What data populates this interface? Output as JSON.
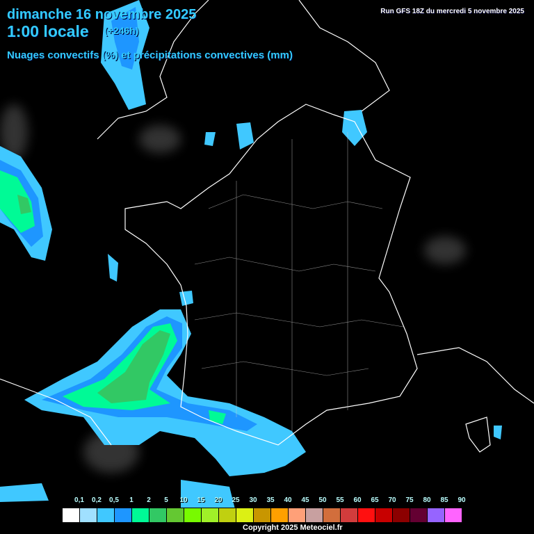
{
  "header": {
    "date": "dimanche 16 novembre 2025",
    "time": "1:00 locale",
    "lead": "(+246h)",
    "subtitle": "Nuages convectifs (%) et précipitations convectives (mm)",
    "run": "Run GFS 18Z du mercredi 5 novembre 2025"
  },
  "legend": {
    "labels": [
      "0,1",
      "0,2",
      "0,5",
      "1",
      "2",
      "5",
      "10",
      "15",
      "20",
      "25",
      "30",
      "35",
      "40",
      "45",
      "50",
      "55",
      "60",
      "65",
      "70",
      "75",
      "80",
      "85",
      "90"
    ],
    "colors": [
      "#ffffff",
      "#a0e0ff",
      "#40c8ff",
      "#1e96ff",
      "#00fa96",
      "#32c864",
      "#64c832",
      "#78fa00",
      "#a0f028",
      "#c0d010",
      "#dcf014",
      "#c89600",
      "#ffa000",
      "#ffa078",
      "#c8a0a0",
      "#d26e3c",
      "#d23c3c",
      "#ff1010",
      "#c80000",
      "#8c0000",
      "#640032",
      "#9664ff",
      "#ff64ff"
    ]
  },
  "copyright": "Copyright 2025 Meteociel.fr"
}
